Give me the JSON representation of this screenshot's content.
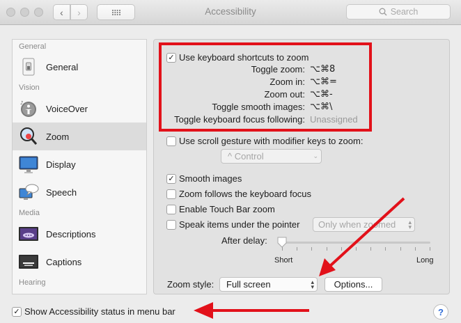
{
  "window": {
    "title": "Accessibility",
    "search_placeholder": "Search"
  },
  "toolbar": {
    "back_glyph": "‹",
    "forward_glyph": "›",
    "grid_glyph": "⠿"
  },
  "sidebar": {
    "sections": {
      "general": "General",
      "vision": "Vision",
      "media": "Media",
      "hearing": "Hearing"
    },
    "items": {
      "general": "General",
      "voiceover": "VoiceOver",
      "zoom": "Zoom",
      "display": "Display",
      "speech": "Speech",
      "descriptions": "Descriptions",
      "captions": "Captions"
    },
    "selected": "Zoom"
  },
  "zoom": {
    "use_shortcuts": {
      "label": "Use keyboard shortcuts to zoom",
      "checked": true
    },
    "shortcuts": [
      {
        "label": "Toggle zoom:",
        "value": "⌥⌘8"
      },
      {
        "label": "Zoom in:",
        "value": "⌥⌘="
      },
      {
        "label": "Zoom out:",
        "value": "⌥⌘-"
      },
      {
        "label": "Toggle smooth images:",
        "value": "⌥⌘\\"
      },
      {
        "label": "Toggle keyboard focus following:",
        "value": "Unassigned"
      }
    ],
    "scroll_gesture": {
      "label": "Use scroll gesture with modifier keys to zoom:",
      "checked": false
    },
    "modifier_popup": "^ Control",
    "smooth_images": {
      "label": "Smooth images",
      "checked": true
    },
    "follow_focus": {
      "label": "Zoom follows the keyboard focus",
      "checked": false
    },
    "touch_bar": {
      "label": "Enable Touch Bar zoom",
      "checked": false
    },
    "speak_items": {
      "label": "Speak items under the pointer",
      "checked": false
    },
    "speak_popup": "Only when zoomed",
    "after_delay": "After delay:",
    "slider": {
      "min_label": "Short",
      "max_label": "Long",
      "value_fraction": 0.0
    },
    "zoom_style": {
      "label": "Zoom style:",
      "value": "Full screen"
    },
    "options_button": "Options..."
  },
  "footer": {
    "status_menu": {
      "label": "Show Accessibility status in menu bar",
      "checked": true
    },
    "help": "?"
  },
  "colors": {
    "annotation_red": "#e2111a",
    "link_blue": "#2d6bd8"
  }
}
